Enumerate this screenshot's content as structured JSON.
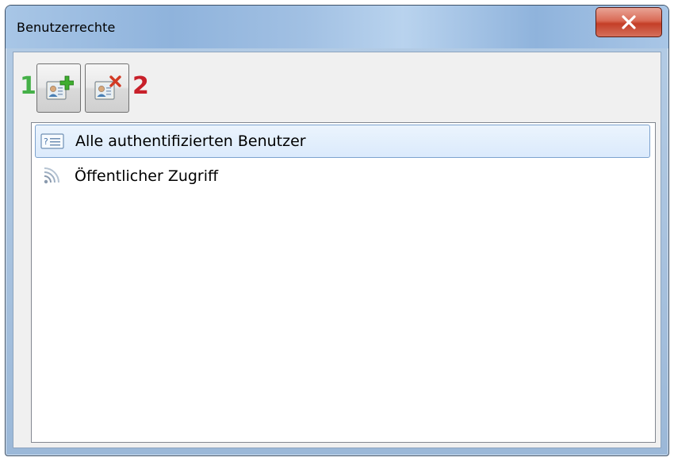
{
  "window": {
    "title": "Benutzerrechte",
    "close_label": "X"
  },
  "toolbar": {
    "add_button_icon": "add-user-icon",
    "remove_button_icon": "remove-user-icon",
    "marker_add": "1",
    "marker_remove": "2",
    "marker_add_color": "#45b048",
    "marker_remove_color": "#c8202a"
  },
  "users_list": {
    "items": [
      {
        "label": "Alle authentifizierten Benutzer",
        "icon": "user-card-icon",
        "selected": true
      },
      {
        "label": "Öffentlicher Zugriff",
        "icon": "rss-feed-icon",
        "selected": false
      }
    ]
  },
  "colors": {
    "selection_background": "#dbeafc",
    "selection_border": "#7da2ce",
    "close_button": "#c43e27"
  }
}
